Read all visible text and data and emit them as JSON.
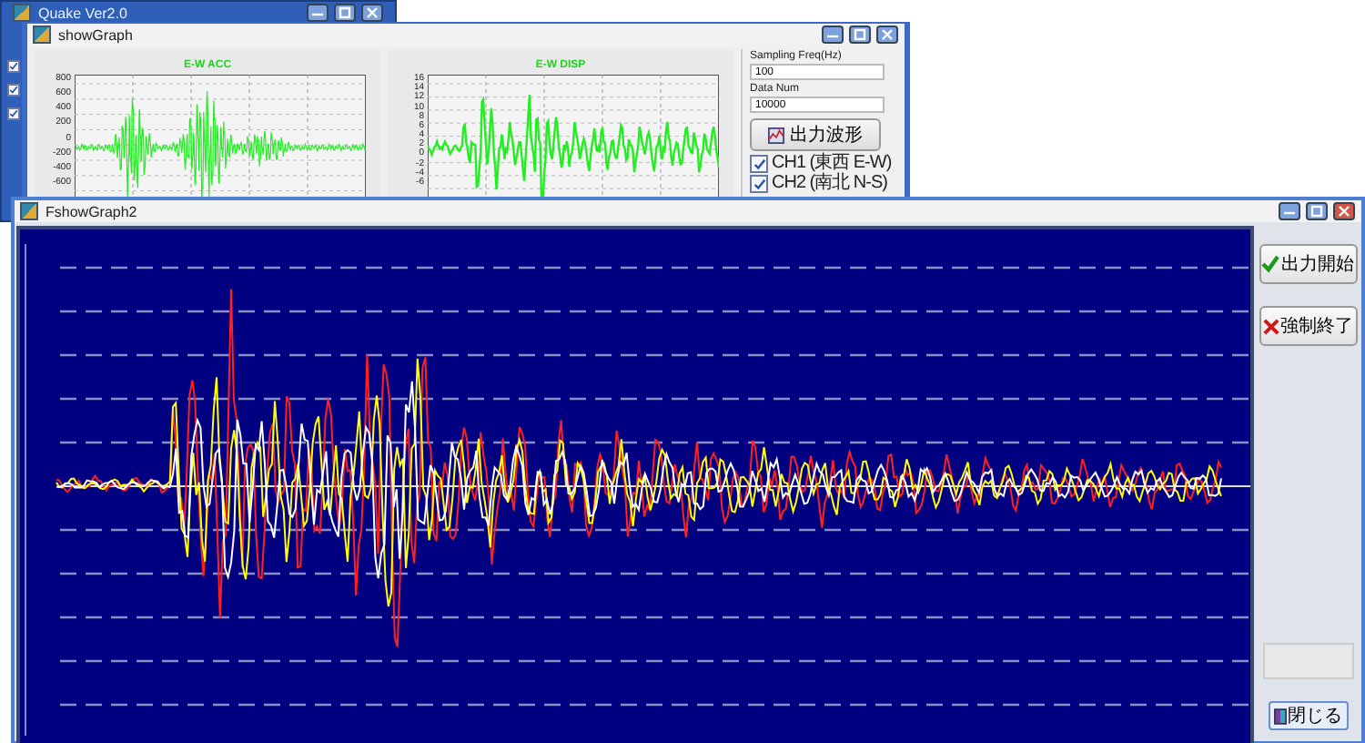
{
  "main_window": {
    "title": "Quake Ver2.0",
    "checkboxes": [
      {
        "checked": true
      },
      {
        "checked": true
      },
      {
        "checked": true
      }
    ]
  },
  "graph_window": {
    "title": "showGraph",
    "charts": [
      {
        "title": "E-W ACC",
        "y_labels": [
          "800",
          "600",
          "400",
          "200",
          "0",
          "-200",
          "-400",
          "-600"
        ]
      },
      {
        "title": "E-W DISP",
        "y_labels": [
          "16",
          "14",
          "12",
          "10",
          "8",
          "6",
          "4",
          "2",
          "0",
          "-2",
          "-4",
          "-6"
        ]
      }
    ],
    "fields": [
      {
        "label": "Sampling Freq(Hz)",
        "value": "100"
      },
      {
        "label": "Data Num",
        "value": "10000"
      }
    ],
    "button": "出力波形",
    "channels": [
      {
        "label": "CH1 (東西 E-W)",
        "checked": true
      },
      {
        "label": "CH2 (南北 N-S)",
        "checked": true
      }
    ]
  },
  "graph2_window": {
    "title": "FshowGraph2",
    "buttons": [
      {
        "kind": "start",
        "label": "出力開始"
      },
      {
        "kind": "stop",
        "label": "強制終了"
      },
      {
        "kind": "close",
        "label": "閉じる"
      }
    ]
  }
}
